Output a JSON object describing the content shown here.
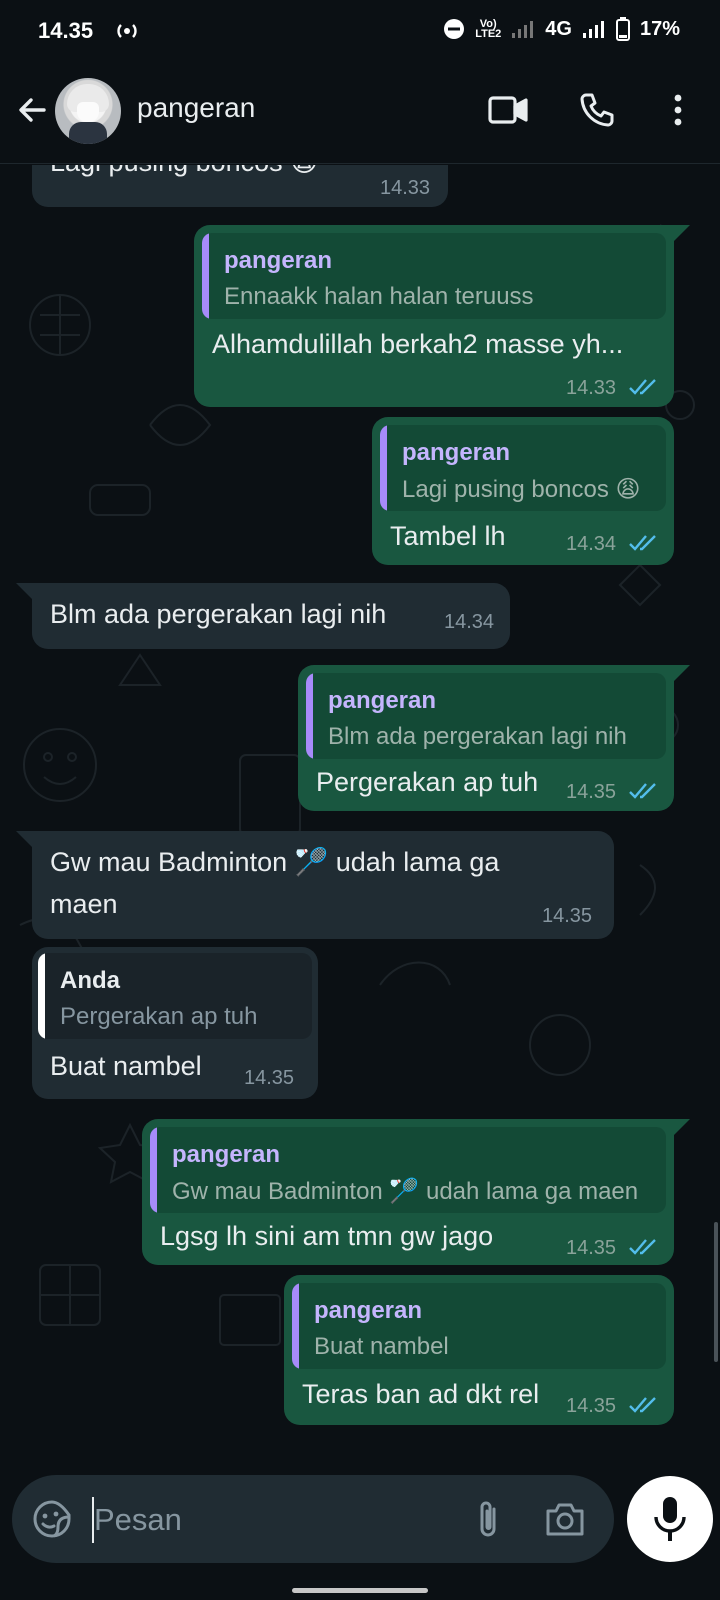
{
  "status_bar": {
    "time": "14.35",
    "volte_top": "Vo)",
    "volte_bottom": "LTE2",
    "network": "4G",
    "battery": "17%"
  },
  "header": {
    "contact_name": "pangeran"
  },
  "messages": [
    {
      "direction": "in",
      "text": "Lagi pusing boncos 😩",
      "time": "14.33"
    },
    {
      "direction": "out",
      "quote_author": "pangeran",
      "quote_text": "Ennaakk halan halan teruuss",
      "text": "Alhamdulillah berkah2 masse yh...",
      "time": "14.33"
    },
    {
      "direction": "out",
      "quote_author": "pangeran",
      "quote_text": "Lagi pusing boncos 😩",
      "text": "Tambel lh",
      "time": "14.34"
    },
    {
      "direction": "in",
      "text": "Blm ada pergerakan lagi nih",
      "time": "14.34"
    },
    {
      "direction": "out",
      "quote_author": "pangeran",
      "quote_text": "Blm ada pergerakan lagi nih",
      "text": "Pergerakan ap tuh",
      "time": "14.35"
    },
    {
      "direction": "in",
      "text": "Gw mau Badminton 🏸 udah lama ga maen",
      "time": "14.35"
    },
    {
      "direction": "in",
      "quote_author": "Anda",
      "quote_text": "Pergerakan ap tuh",
      "text": "Buat nambel",
      "time": "14.35"
    },
    {
      "direction": "out",
      "quote_author": "pangeran",
      "quote_text": "Gw mau Badminton 🏸 udah lama ga maen",
      "text": "Lgsg lh sini am tmn gw jago",
      "time": "14.35"
    },
    {
      "direction": "out",
      "quote_author": "pangeran",
      "quote_text": "Buat nambel",
      "text": "Teras ban ad dkt rel",
      "time": "14.35"
    }
  ],
  "input": {
    "placeholder": "Pesan"
  },
  "colors": {
    "background": "#0b1014",
    "incoming_bubble": "#202c33",
    "outgoing_bubble": "#195740",
    "quote_bar_pangeran": "#a78bfa",
    "quote_bar_anda": "#ffffff",
    "quote_author_pangeran": "#c4b5fd",
    "read_ticks": "#53bdeb"
  },
  "icons": [
    "back-arrow-icon",
    "video-call-icon",
    "phone-icon",
    "more-vert-icon",
    "sticker-icon",
    "attach-icon",
    "camera-icon",
    "mic-icon"
  ]
}
